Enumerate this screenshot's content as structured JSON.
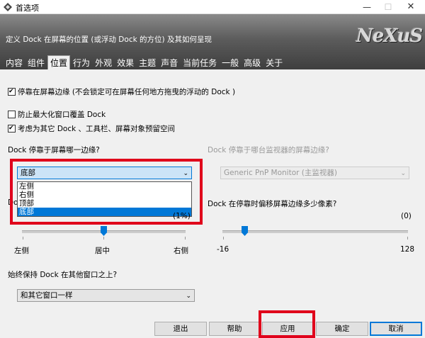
{
  "window": {
    "title": "首选项"
  },
  "banner": {
    "description": "定义 Dock 在屏幕的位置 (或浮动 Dock 的方位) 及其如何呈现",
    "logo": "NeXuS"
  },
  "tabs": [
    {
      "label": "内容"
    },
    {
      "label": "组件"
    },
    {
      "label": "位置"
    },
    {
      "label": "行为"
    },
    {
      "label": "外观"
    },
    {
      "label": "效果"
    },
    {
      "label": "主题"
    },
    {
      "label": "声音"
    },
    {
      "label": "当前任务"
    },
    {
      "label": "一般"
    },
    {
      "label": "高级"
    },
    {
      "label": "关于"
    }
  ],
  "options": {
    "dock_at_edge": {
      "label": "停靠在屏幕边缘 (不会锁定可在屏幕任何地方拖曳的浮动的 Dock )",
      "checked": true
    },
    "prevent_max_cover": {
      "label": "防止最大化窗口覆盖 Dock",
      "checked": false
    },
    "reserve_space": {
      "label": "考虑为其它 Dock 、工具栏、屏幕对象预留空间",
      "checked": true
    }
  },
  "edge": {
    "label": "Dock 停靠于屏幕哪一边缘?",
    "selected": "底部",
    "options": [
      "左侧",
      "右侧",
      "顶部",
      "底部"
    ],
    "label_hidden_prefix": "Do"
  },
  "monitor": {
    "label": "Dock 停靠于哪台监视器的屏幕边缘?",
    "selected": "Generic PnP Monitor (主监视器)"
  },
  "position_slider": {
    "value_text": "(1%)",
    "min_label": "左侧",
    "mid_label": "居中",
    "max_label": "右侧",
    "value_fraction": 0.5
  },
  "offset": {
    "label": "Dock 在停靠时偏移屏幕边缘多少像素?",
    "value_text": "(0)",
    "min_label": "-16",
    "max_label": "128",
    "value_fraction": 0.111
  },
  "always_on_top": {
    "label": "始终保持 Dock 在其他窗口之上?",
    "selected": "和其它窗口一样"
  },
  "buttons": {
    "exit": "退出",
    "help": "帮助",
    "apply": "应用",
    "ok": "确定",
    "cancel": "取消"
  }
}
